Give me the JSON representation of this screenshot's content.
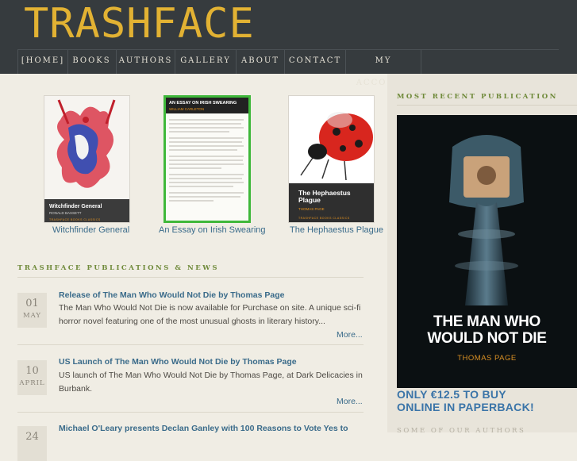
{
  "site": {
    "logo": "TRASHFACE"
  },
  "nav": [
    {
      "label": "[HOME]"
    },
    {
      "label": "BOOKS"
    },
    {
      "label": "AUTHORS"
    },
    {
      "label": "GALLERY"
    },
    {
      "label": "ABOUT"
    },
    {
      "label": "CONTACT"
    },
    {
      "label": "MY ACCOUNT"
    }
  ],
  "books": [
    {
      "title": "Witchfinder General",
      "cover_title": "Witchfinder General",
      "cover_author": "RONALD BASSETT",
      "series": "TRASHFACE BOOKS CLASSICS"
    },
    {
      "title": "An Essay on Irish Swearing",
      "cover_title": "AN ESSAY ON IRISH SWEARING",
      "cover_author": "WILLIAM CARLETON"
    },
    {
      "title": "The Hephaestus Plague",
      "cover_title": "The Hephaestus Plague",
      "cover_author": "THOMAS PAGE",
      "series": "TRASHFACE BOOKS CLASSICS"
    }
  ],
  "news_section": {
    "heading": "TRASHFACE PUBLICATIONS & NEWS"
  },
  "news": [
    {
      "day": "01",
      "month": "MAY",
      "title": "Release of The Man Who Would Not Die by Thomas Page",
      "body": "The Man Who Would Not Die is now available for Purchase on site. A unique sci-fi horror novel featuring one of the most unusual ghosts in literary history...",
      "more": "More..."
    },
    {
      "day": "10",
      "month": "APRIL",
      "title": "US Launch of The Man Who Would Not Die by Thomas Page",
      "body": "US launch of The Man Who Would Not Die by Thomas Page, at Dark Delicacies in Burbank.",
      "more": "More..."
    },
    {
      "day": "24",
      "month": "",
      "title": "Michael O'Leary presents Declan Ganley with 100 Reasons to Vote Yes to",
      "body": "",
      "more": ""
    }
  ],
  "sidebar": {
    "heading": "MOST RECENT PUBLICATION",
    "poster_title_1": "THE MAN WHO",
    "poster_title_2": "WOULD NOT DIE",
    "poster_author": "THOMAS PAGE",
    "promo_1": "ONLY €12.5 TO BUY",
    "promo_2": "ONLINE IN PAPERBACK!",
    "heading2": "SOME OF OUR AUTHORS"
  },
  "colors": {
    "accent_orange": "#e8941e",
    "link_blue": "#3a6b8a",
    "heading_green": "#6f8a3a",
    "topbar": "#363b3e"
  }
}
